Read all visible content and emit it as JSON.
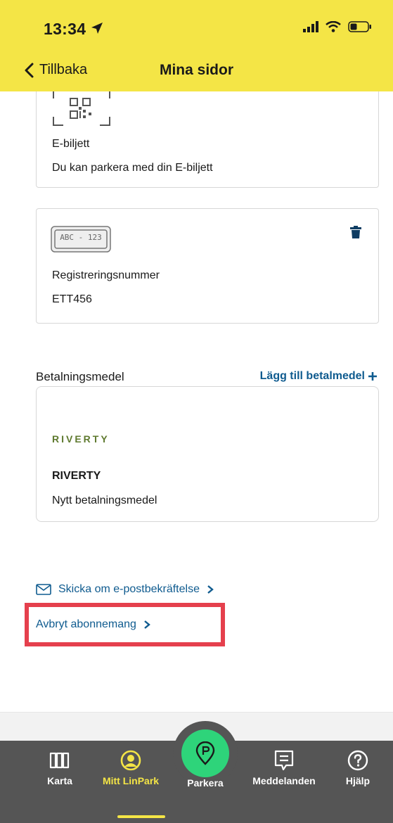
{
  "status_bar": {
    "time": "13:34"
  },
  "nav": {
    "back_label": "Tillbaka",
    "title": "Mina sidor"
  },
  "ebiljett": {
    "title": "E-biljett",
    "description": "Du kan parkera med din E-biljett"
  },
  "registration": {
    "plate_text": "ABC - 123",
    "title": "Registreringsnummer",
    "value": "ETT456"
  },
  "payment": {
    "section_title": "Betalningsmedel",
    "add_label": "Lägg till betalmedel",
    "card": {
      "logo_text": "RIVERTY",
      "name": "RIVERTY",
      "description": "Nytt betalningsmedel"
    }
  },
  "links": {
    "resend_email": "Skicka om e-postbekräftelse",
    "cancel_subscription": "Avbryt abonnemang"
  },
  "bottom_nav": {
    "items": [
      {
        "label": "Karta",
        "icon": "map-icon"
      },
      {
        "label": "Mitt LinPark",
        "icon": "user-circle-icon",
        "active": true
      },
      {
        "label": "Parkera",
        "icon": "parking-pin-icon"
      },
      {
        "label": "Meddelanden",
        "icon": "message-icon"
      },
      {
        "label": "Hjälp",
        "icon": "help-icon"
      }
    ]
  },
  "colors": {
    "header_bg": "#f4e546",
    "link": "#0f5b8f",
    "nav_bg": "#555555",
    "active": "#f4e546",
    "parkera": "#2ed47a",
    "highlight": "#e5404d"
  }
}
